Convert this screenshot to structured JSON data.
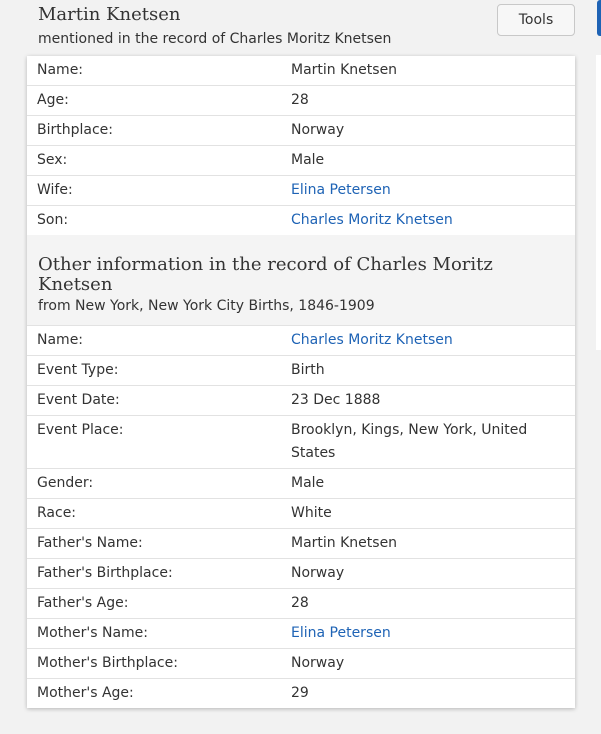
{
  "header": {
    "person_name": "Martin Knetsen",
    "subtitle": "mentioned in the record of Charles Moritz Knetsen",
    "tools_label": "Tools"
  },
  "person_rows": [
    {
      "label": "Name:",
      "value": "Martin Knetsen",
      "link": false
    },
    {
      "label": "Age:",
      "value": "28",
      "link": false
    },
    {
      "label": "Birthplace:",
      "value": "Norway",
      "link": false
    },
    {
      "label": "Sex:",
      "value": "Male",
      "link": false
    },
    {
      "label": "Wife:",
      "value": "Elina Petersen",
      "link": true
    },
    {
      "label": "Son:",
      "value": "Charles Moritz Knetsen",
      "link": true
    }
  ],
  "other_section": {
    "title": "Other information in the record of Charles Moritz Knetsen",
    "subtitle": "from New York, New York City Births, 1846-1909"
  },
  "record_rows": [
    {
      "label": "Name:",
      "value": "Charles Moritz Knetsen",
      "link": true
    },
    {
      "label": "Event Type:",
      "value": "Birth",
      "link": false
    },
    {
      "label": "Event Date:",
      "value": "23 Dec 1888",
      "link": false
    },
    {
      "label": "Event Place:",
      "value": "Brooklyn, Kings, New York, United States",
      "link": false
    },
    {
      "label": "Gender:",
      "value": "Male",
      "link": false
    },
    {
      "label": "Race:",
      "value": "White",
      "link": false
    },
    {
      "label": "Father's Name:",
      "value": "Martin Knetsen",
      "link": false
    },
    {
      "label": "Father's Birthplace:",
      "value": "Norway",
      "link": false
    },
    {
      "label": "Father's Age:",
      "value": "28",
      "link": false
    },
    {
      "label": "Mother's Name:",
      "value": "Elina Petersen",
      "link": true
    },
    {
      "label": "Mother's Birthplace:",
      "value": "Norway",
      "link": false
    },
    {
      "label": "Mother's Age:",
      "value": "29",
      "link": false
    }
  ],
  "colors": {
    "link": "#1e63b5",
    "background": "#f2f2f2"
  }
}
